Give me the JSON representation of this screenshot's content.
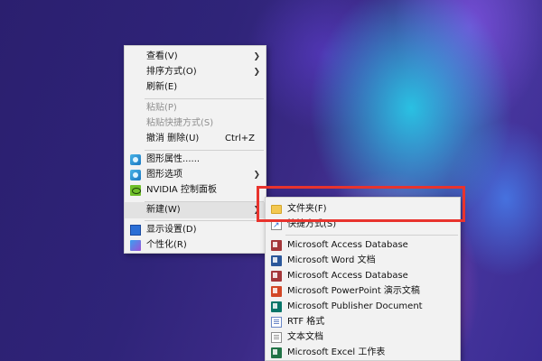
{
  "desktop": {
    "context_menu": {
      "items": [
        {
          "label": "查看(V)",
          "has_submenu": true
        },
        {
          "label": "排序方式(O)",
          "has_submenu": true
        },
        {
          "label": "刷新(E)"
        },
        {
          "label": "粘贴(P)",
          "disabled": true
        },
        {
          "label": "粘贴快捷方式(S)",
          "disabled": true
        },
        {
          "label": "撤消 删除(U)",
          "shortcut": "Ctrl+Z"
        },
        {
          "label": "图形属性......",
          "icon": "graphics-icon"
        },
        {
          "label": "图形选项",
          "icon": "graphics-icon",
          "has_submenu": true
        },
        {
          "label": "NVIDIA 控制面板",
          "icon": "nvidia-icon"
        },
        {
          "label": "新建(W)",
          "has_submenu": true,
          "hovered": true
        },
        {
          "label": "显示设置(D)",
          "icon": "display-icon"
        },
        {
          "label": "个性化(R)",
          "icon": "personalize-icon"
        }
      ]
    },
    "new_submenu": {
      "items": [
        {
          "label": "文件夹(F)",
          "icon": "folder-icon"
        },
        {
          "label": "快捷方式(S)",
          "icon": "shortcut-icon"
        },
        {
          "label": "Microsoft Access Database",
          "icon": "access-icon"
        },
        {
          "label": "Microsoft Word 文档",
          "icon": "word-icon"
        },
        {
          "label": "Microsoft Access Database",
          "icon": "access-icon"
        },
        {
          "label": "Microsoft PowerPoint 演示文稿",
          "icon": "powerpoint-icon"
        },
        {
          "label": "Microsoft Publisher Document",
          "icon": "publisher-icon"
        },
        {
          "label": "RTF 格式",
          "icon": "rtf-icon"
        },
        {
          "label": "文本文档",
          "icon": "text-document-icon"
        },
        {
          "label": "Microsoft Excel 工作表",
          "icon": "excel-icon"
        }
      ]
    },
    "colors": {
      "highlight_box": "#e8332d",
      "menu_background": "#f2f2f2",
      "hover_background": "#e2e2e2"
    }
  }
}
